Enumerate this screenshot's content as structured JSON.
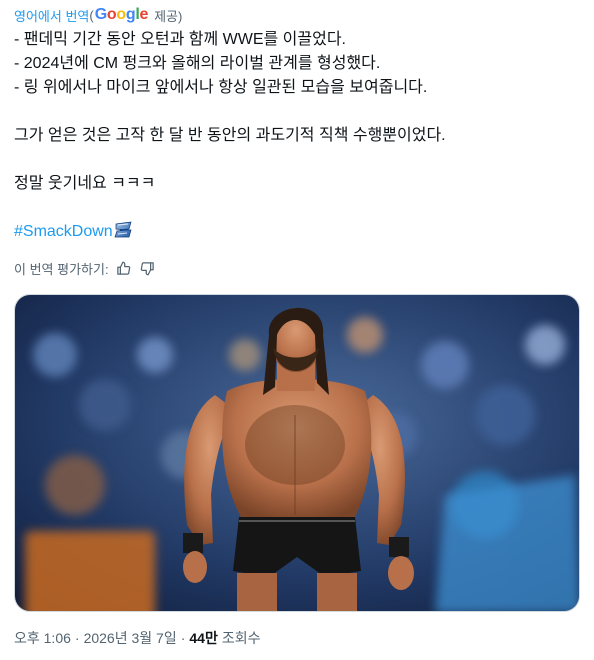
{
  "translation": {
    "source_label": "영어에서 번역",
    "open_paren": "(",
    "google_letters": [
      "G",
      "o",
      "o",
      "g",
      "l",
      "e"
    ],
    "provided": "제공)"
  },
  "tweet": {
    "lines": [
      "- 팬데믹 기간 동안 오턴과 함께 WWE를 이끌었다.",
      "- 2024년에 CM 펑크와 올해의 라이벌 관계를 형성했다.",
      "- 링 위에서나 마이크 앞에서나 항상 일관된 모습을 보여줍니다.",
      "그가 얻은 것은 고작 한 달 반 동안의 과도기적 직책 수행뿐이었다.",
      "정말 웃기네요 ㅋㅋㅋ"
    ],
    "hashtag": "#SmackDown"
  },
  "rate": {
    "label": "이 번역 평가하기:",
    "thumb_up_icon": "thumbs-up-icon",
    "thumb_down_icon": "thumbs-down-icon"
  },
  "media": {
    "alt": "wrestler-photo"
  },
  "meta": {
    "time": "오후 1:06",
    "separator": "·",
    "date": "2026년 3월 7일",
    "views_count": "44만",
    "views_label": "조회수"
  },
  "colors": {
    "link": "#1d9bf0",
    "secondary_text": "#536471",
    "primary_text": "#0f1419",
    "border": "#cfd9de"
  }
}
